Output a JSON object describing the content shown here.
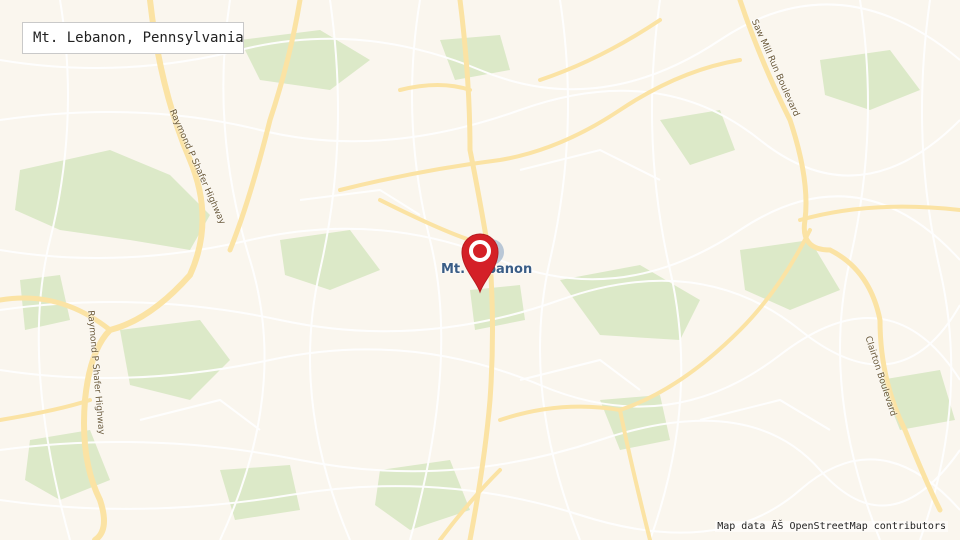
{
  "search": {
    "value": "Mt. Lebanon, Pennsylvania"
  },
  "map": {
    "place_label": "Mt. Lebanon",
    "road_labels": {
      "shafer_north": "Raymond P Shafer Highway",
      "shafer_south": "Raymond P Shafer Highway",
      "saw_mill": "Saw Mill Run Boulevard",
      "clairton": "Clairton Boulevard"
    },
    "attribution": "Map data ĂŠ OpenStreetMap contributors",
    "marker_icon": "map-pin-icon",
    "colors": {
      "background": "#faf6ee",
      "park": "#d8e8c4",
      "road_major": "#fbe3a4",
      "road_minor": "#ffffff",
      "marker": "#d42027",
      "place_label": "#3a5d86"
    }
  }
}
